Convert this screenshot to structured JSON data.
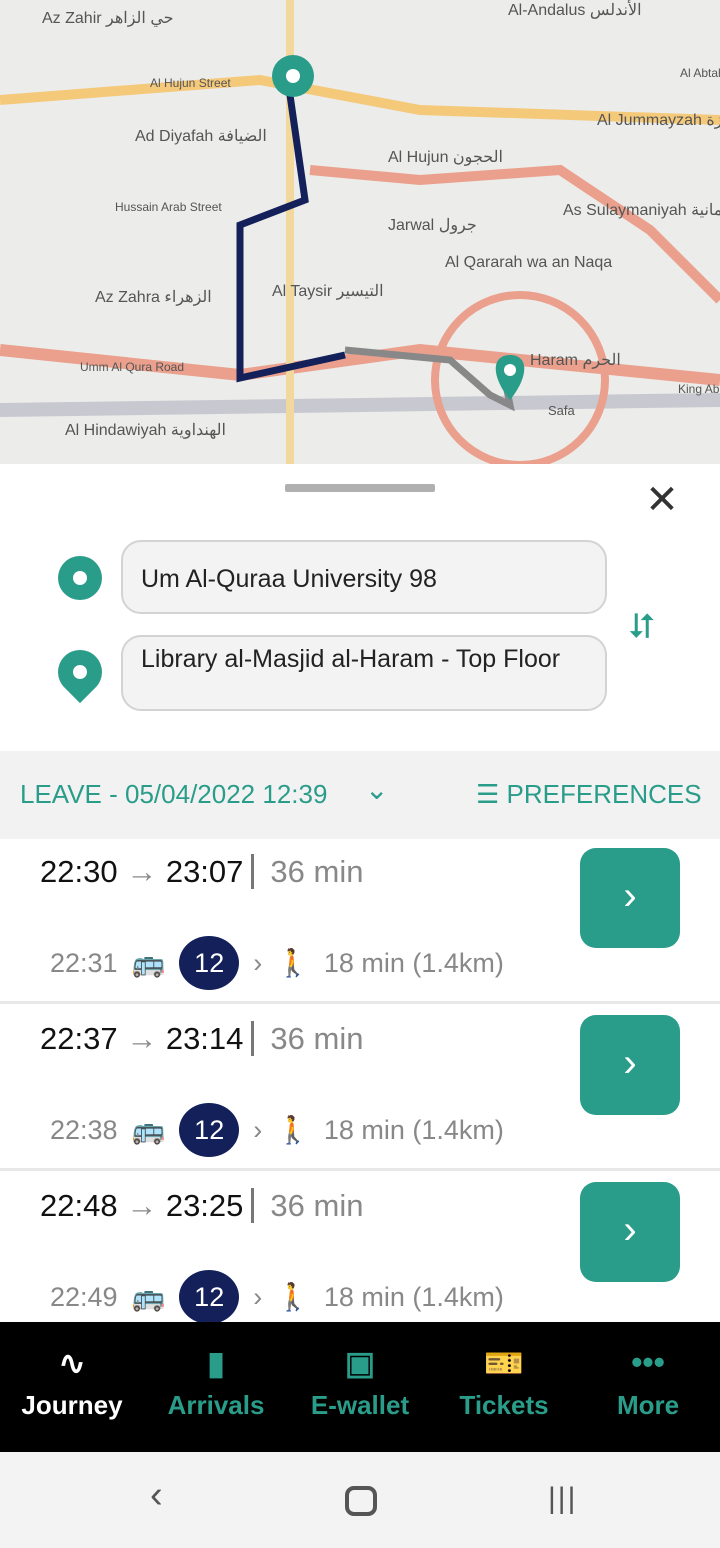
{
  "map": {
    "labels": [
      "Az Zahir حي الزاهر",
      "Al Hujun Street",
      "Ad Diyafah الضيافة",
      "Hussain Arab Street",
      "Al-Andalus الأندلس",
      "Al Jummayzah الجميزة",
      "Al Hujun الحجون",
      "As Sulaymaniyah السليمانية",
      "Jarwal جرول",
      "Al Qararah wa an Naqa",
      "Az Zahra الزهراء",
      "Al Taysir التيسير",
      "Umm Al Qura Road",
      "Al Hindawiyah الهنداوية",
      "Haram الحرم",
      "Safa",
      "King Ab",
      "Al Abtah"
    ],
    "route_color": "#13205a",
    "walk_color": "#888888"
  },
  "sheet": {
    "from": "Um Al-Quraa University 98",
    "to": "Library al-Masjid al-Haram - Top Floor",
    "close_icon": "close-icon",
    "swap_icon": "swap-icon"
  },
  "options": {
    "leave": "LEAVE - 05/04/2022 12:39",
    "preferences": "PREFERENCES"
  },
  "results": [
    {
      "depart": "22:30",
      "arrive": "23:07",
      "duration": "36 min",
      "board": "22:31",
      "line": "12",
      "walk": "18 min (1.4km)"
    },
    {
      "depart": "22:37",
      "arrive": "23:14",
      "duration": "36 min",
      "board": "22:38",
      "line": "12",
      "walk": "18 min (1.4km)"
    },
    {
      "depart": "22:48",
      "arrive": "23:25",
      "duration": "36 min",
      "board": "22:49",
      "line": "12",
      "walk": "18 min (1.4km)"
    }
  ],
  "nav": {
    "items": [
      "Journey",
      "Arrivals",
      "E-wallet",
      "Tickets",
      "More"
    ],
    "active": "Journey"
  },
  "colors": {
    "accent": "#2a9d8a",
    "line": "#13205a"
  }
}
